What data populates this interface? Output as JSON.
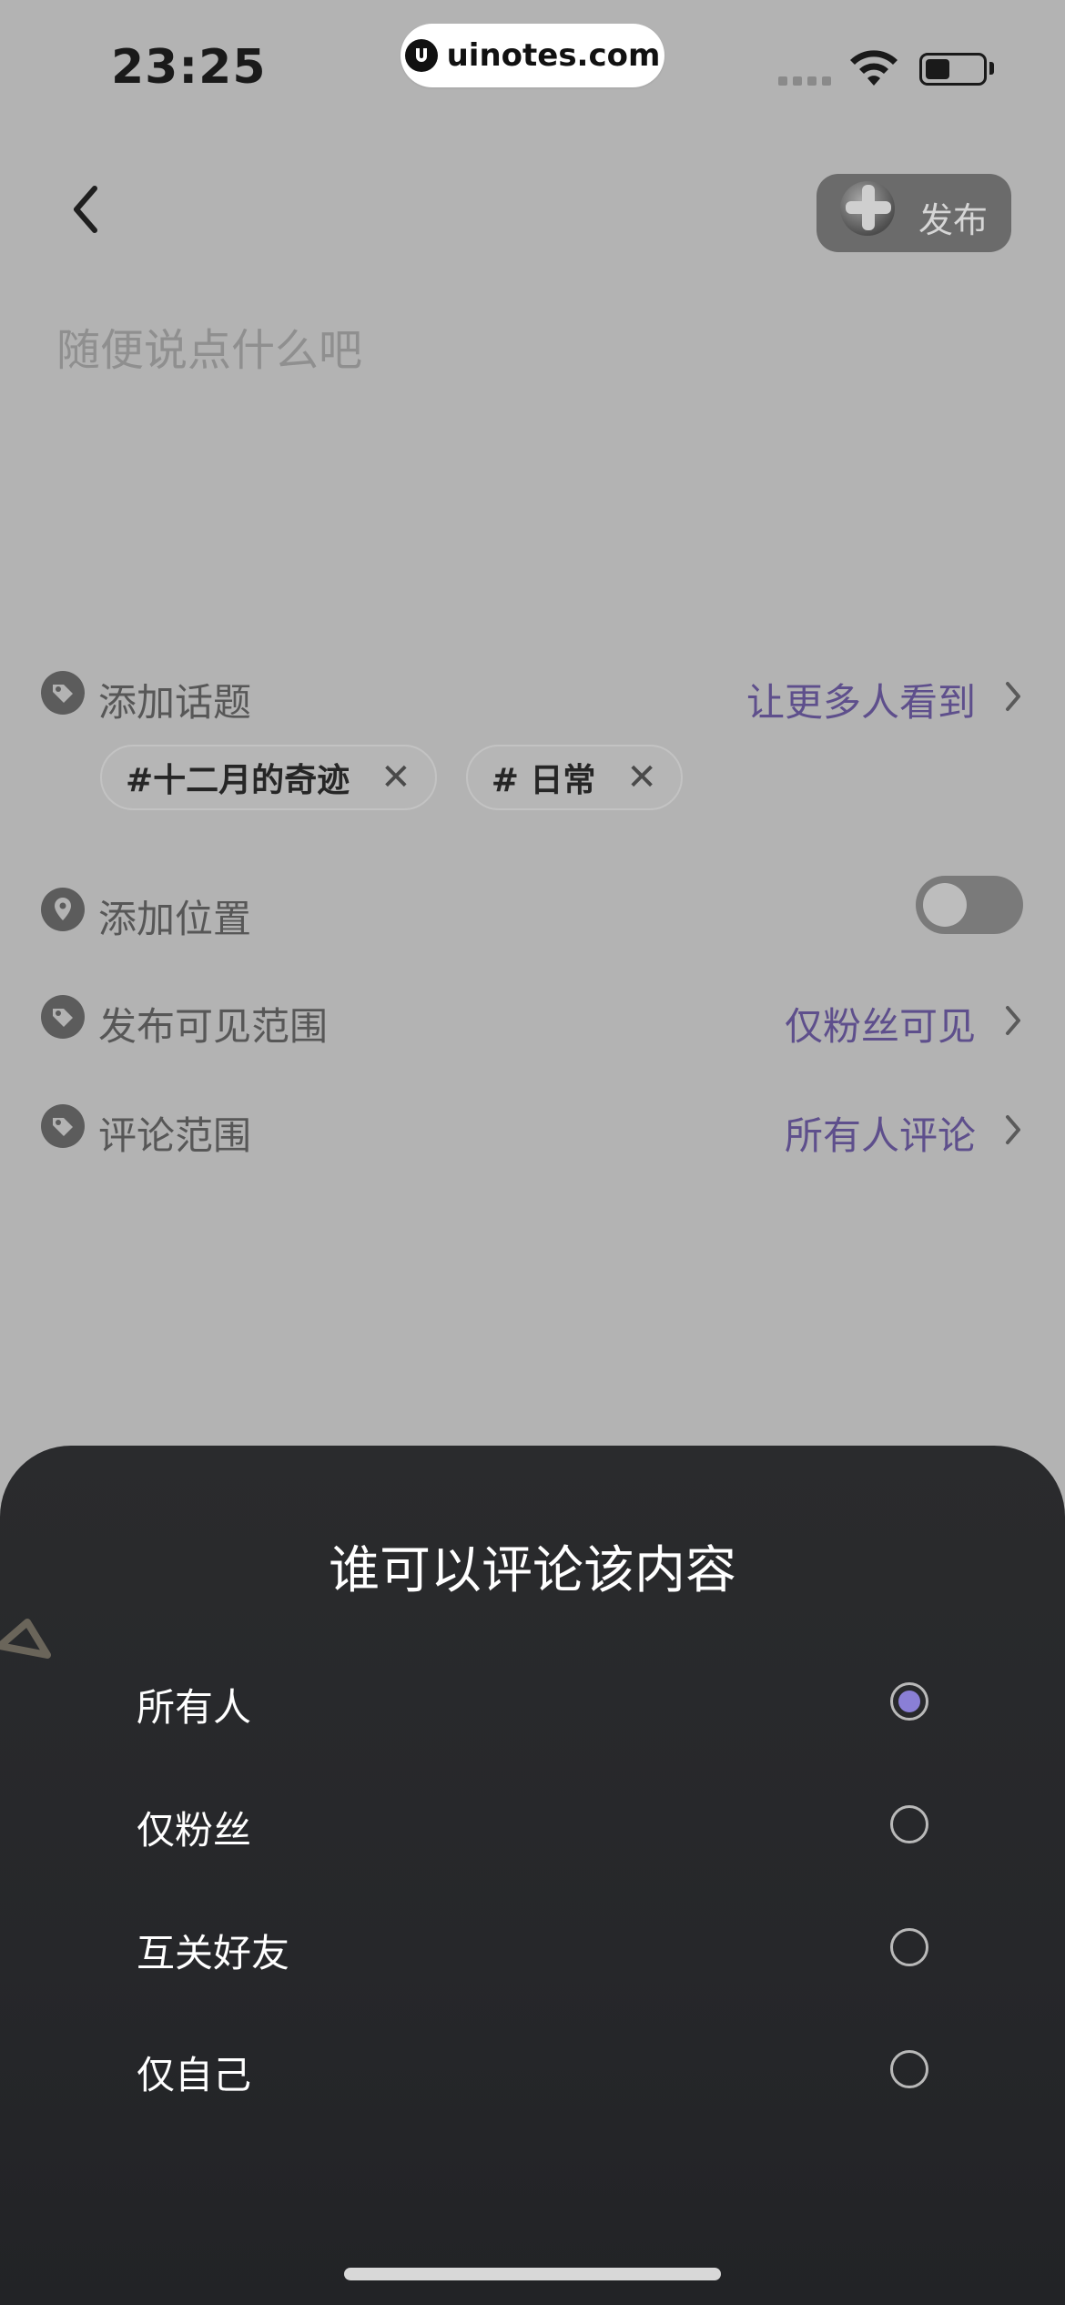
{
  "status_bar": {
    "time": "23:25",
    "url": "uinotes.com"
  },
  "header": {
    "publish_label": "发布"
  },
  "compose": {
    "placeholder": "随便说点什么吧"
  },
  "settings": {
    "topic": {
      "label": "添加话题",
      "value": "让更多人看到"
    },
    "topics": [
      "#十二月的奇迹",
      "# 日常"
    ],
    "location": {
      "label": "添加位置",
      "enabled": false
    },
    "visibility": {
      "label": "发布可见范围",
      "value": "仅粉丝可见"
    },
    "comments": {
      "label": "评论范围",
      "value": "所有人评论"
    }
  },
  "sheet": {
    "title": "谁可以评论该内容",
    "options": [
      {
        "label": "所有人",
        "selected": true
      },
      {
        "label": "仅粉丝",
        "selected": false
      },
      {
        "label": "互关好友",
        "selected": false
      },
      {
        "label": "仅自己",
        "selected": false
      }
    ]
  },
  "colors": {
    "accent_text": "#5e4f8c",
    "radio_selected": "#8a7fd6"
  }
}
